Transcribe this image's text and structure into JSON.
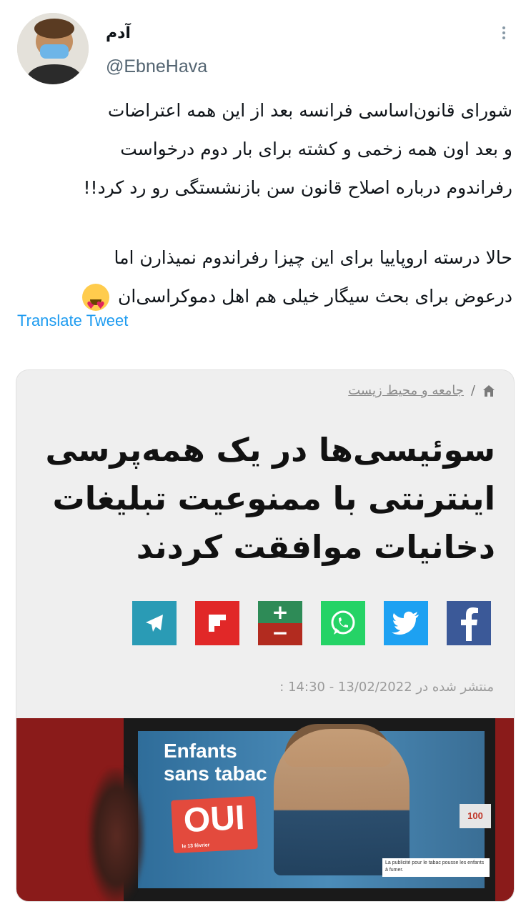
{
  "user": {
    "name": "آدم",
    "handle": "@EbneHava"
  },
  "tweet": {
    "lines_p1": [
      "شورای قانون‌اساسی فرانسه بعد از این همه اعتراضات",
      "و بعد اون همه زخمی و کشته برای بار دوم درخواست",
      "رفراندوم درباره اصلاح قانون سن بازنشستگی رو رد کرد!!"
    ],
    "lines_p2": [
      "حالا درسته اروپاییا برای این چیزا رفراندوم نمیذارن اما",
      "درعوض برای بحث سیگار خیلی هم اهل دموکراسی‌ان"
    ],
    "emoji": "smiling-face-with-heart-eyes"
  },
  "translate_label": "Translate Tweet",
  "article": {
    "breadcrumb": "جامعه و محیط زیست",
    "breadcrumb_sep": "/",
    "headline_lines": [
      "سوئیسی‌ها در یک همه‌پرسی",
      "اینترنتی با ممنوعیت تبلیغات",
      "دخانیات موافقت کردند"
    ],
    "share_buttons": [
      {
        "name": "facebook",
        "color": "#3b5998"
      },
      {
        "name": "twitter",
        "color": "#1da1f2"
      },
      {
        "name": "whatsapp",
        "color": "#25d366"
      },
      {
        "name": "balatarin",
        "color": "#b22b1f"
      },
      {
        "name": "flipboard",
        "color": "#e12828"
      },
      {
        "name": "telegram",
        "color": "#2a9bb5"
      }
    ],
    "published": "منتشر شده در 13/02/2022 - 14:30 :",
    "photo": {
      "poster_line1": "Enfants",
      "poster_line2": "sans tabac",
      "oui": "OUI",
      "oui_sub": "le 13 février",
      "caption": "La publicité pour le tabac pousse les enfants à fumer.",
      "badge": "100"
    }
  },
  "colors": {
    "link": "#1d9bf0",
    "text": "#0f1419",
    "muted": "#536471"
  }
}
